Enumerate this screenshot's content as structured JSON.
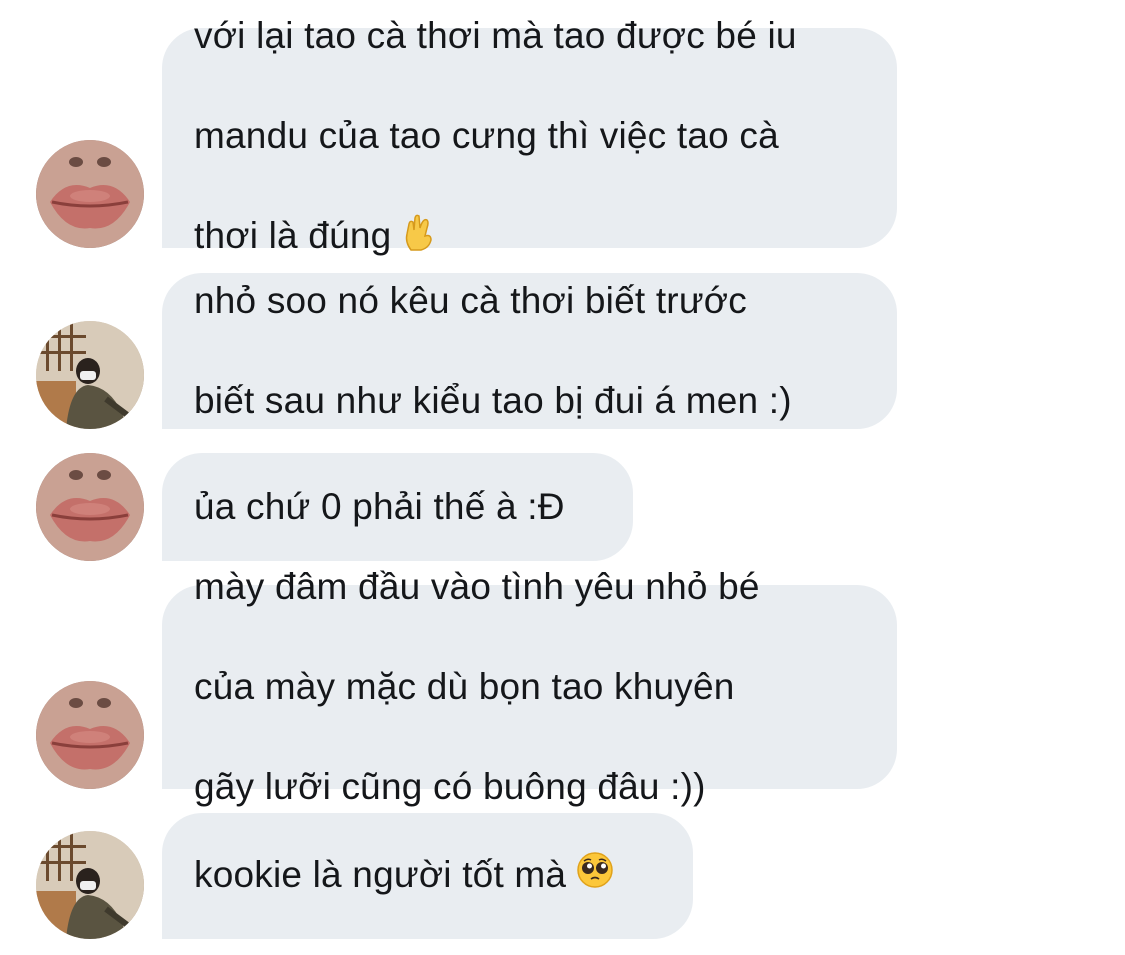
{
  "conversation": {
    "messages": [
      {
        "sender": "lips-avatar",
        "lines": [
          "với lại tao cà thơi mà tao được bé iu",
          "mandu của tao cưng thì việc tao cà",
          "thơi là đúng"
        ],
        "emoji": "pinched-fingers-icon"
      },
      {
        "sender": "boy-avatar",
        "lines": [
          "nhỏ soo nó kêu cà thơi biết trước",
          "biết sau như kiểu tao bị đui á men :)"
        ]
      },
      {
        "sender": "lips-avatar",
        "lines": [
          "ủa chứ 0 phải thế à :Đ"
        ]
      },
      {
        "sender": "lips-avatar",
        "lines": [
          "mày đâm đầu vào tình yêu nhỏ bé",
          "của mày mặc dù bọn tao khuyên",
          "gãy lưỡi cũng có buông đâu :))"
        ]
      },
      {
        "sender": "boy-avatar",
        "lines": [
          "kookie là người tốt mà"
        ],
        "emoji": "pleading-face-icon"
      }
    ]
  },
  "colors": {
    "bubble_background": "#e9edf1",
    "text": "#15171a",
    "page_background": "#ffffff"
  }
}
